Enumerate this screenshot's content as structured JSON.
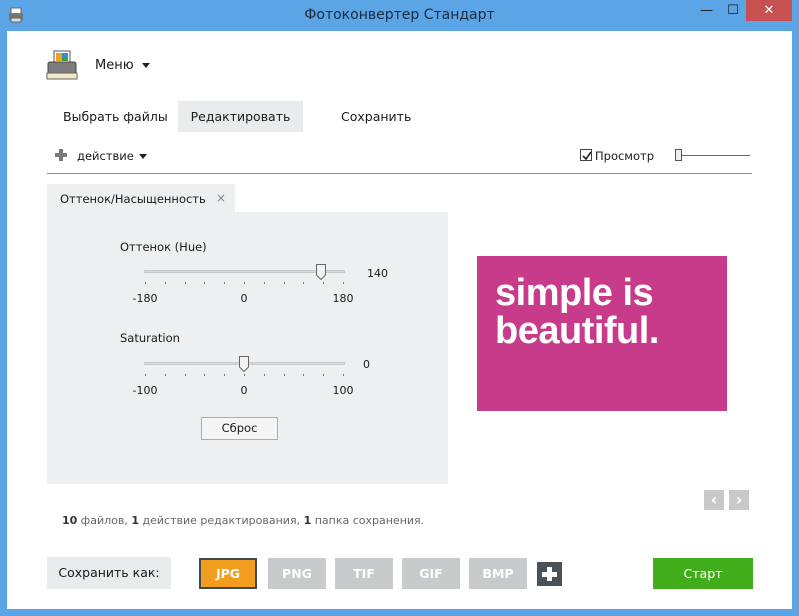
{
  "window": {
    "title": "Фотоконвертер Стандарт",
    "minimize_glyph": "—",
    "maximize_glyph": "☐",
    "close_glyph": "✕"
  },
  "menu": {
    "label": "Меню"
  },
  "tabs": [
    {
      "label": "Выбрать файлы",
      "active": false
    },
    {
      "label": "Редактировать",
      "active": true
    },
    {
      "label": "Сохранить",
      "active": false
    }
  ],
  "toolbar": {
    "action_label": "действие",
    "preview_label": "Просмотр",
    "preview_checked": true
  },
  "panel": {
    "tab_label": "Оттенок/Насыщенность",
    "close_glyph": "×",
    "hue": {
      "title": "Оттенок (Hue)",
      "min_label": "-180",
      "mid_label": "0",
      "max_label": "180",
      "min": -180,
      "max": 180,
      "value_label": "140",
      "value": 140
    },
    "saturation": {
      "title": "Saturation",
      "min_label": "-100",
      "mid_label": "0",
      "max_label": "100",
      "min": -100,
      "max": 100,
      "value_label": "0",
      "value": 0
    },
    "reset_label": "Сброс"
  },
  "preview": {
    "line1": "simple is",
    "line2": "beautiful.",
    "background": "#c73b8a"
  },
  "nav": {
    "prev_glyph": "‹",
    "next_glyph": "›"
  },
  "status": {
    "files_count": "10",
    "files_text": " файлов, ",
    "actions_count": "1",
    "actions_text": " действие редактирования, ",
    "folders_count": "1",
    "folders_text": " папка сохранения."
  },
  "save": {
    "label": "Сохранить как:",
    "formats": [
      {
        "label": "JPG",
        "active": true
      },
      {
        "label": "PNG",
        "active": false
      },
      {
        "label": "TIF",
        "active": false
      },
      {
        "label": "GIF",
        "active": false
      },
      {
        "label": "BMP",
        "active": false
      }
    ],
    "start_label": "Старт"
  },
  "colors": {
    "accent_orange": "#f29d1e",
    "start_green": "#41ad1a",
    "titlebar_blue": "#5ba4e6",
    "close_red": "#c75050"
  }
}
